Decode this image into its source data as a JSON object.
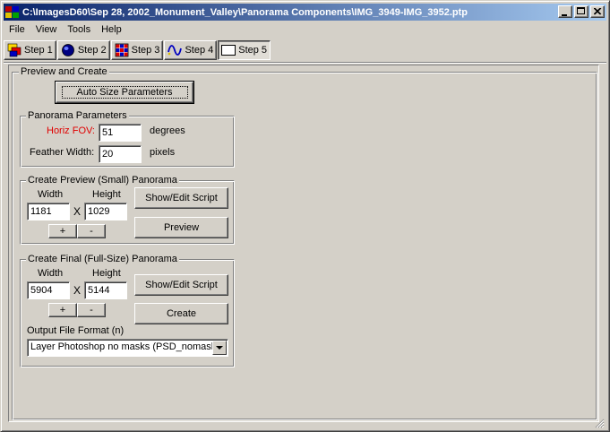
{
  "window": {
    "title": "C:\\ImagesD60\\Sep 28, 2002_Monument_Valley\\Panorama Components\\IMG_3949-IMG_3952.ptp",
    "minimize_glyph": "_",
    "maximize_glyph": "□",
    "close_glyph": "✕"
  },
  "menu": [
    "File",
    "View",
    "Tools",
    "Help"
  ],
  "steps": [
    {
      "label": "Step 1",
      "icon": "images-icon"
    },
    {
      "label": "Step 2",
      "icon": "lens-icon"
    },
    {
      "label": "Step 3",
      "icon": "grid-icon"
    },
    {
      "label": "Step 4",
      "icon": "wave-icon"
    },
    {
      "label": "Step 5",
      "icon": "panorama-icon"
    }
  ],
  "main": {
    "title": "Preview and Create",
    "auto_size_label": "Auto Size Parameters",
    "panorama_params": {
      "title": "Panorama Parameters",
      "hfov_label": "Horiz FOV:",
      "hfov_value": "51",
      "hfov_unit": "degrees",
      "feather_label": "Feather Width:",
      "feather_value": "20",
      "feather_unit": "pixels"
    },
    "preview": {
      "title": "Create Preview (Small) Panorama",
      "width_label": "Width",
      "height_label": "Height",
      "width_value": "1181",
      "height_value": "1029",
      "times": "X",
      "plus": "+",
      "minus": "-",
      "script_label": "Show/Edit Script",
      "action_label": "Preview"
    },
    "final": {
      "title": "Create Final (Full-Size) Panorama",
      "width_label": "Width",
      "height_label": "Height",
      "width_value": "5904",
      "height_value": "5144",
      "times": "X",
      "plus": "+",
      "minus": "-",
      "script_label": "Show/Edit Script",
      "action_label": "Create",
      "format_label": "Output File Format (n)",
      "format_value": "Layer Photoshop no masks (PSD_nomask)"
    }
  },
  "colors": {
    "title_gradient_start": "#0a246a",
    "title_gradient_end": "#a6caf0",
    "hfov_label": "#e00000",
    "face": "#d4d0c8"
  }
}
